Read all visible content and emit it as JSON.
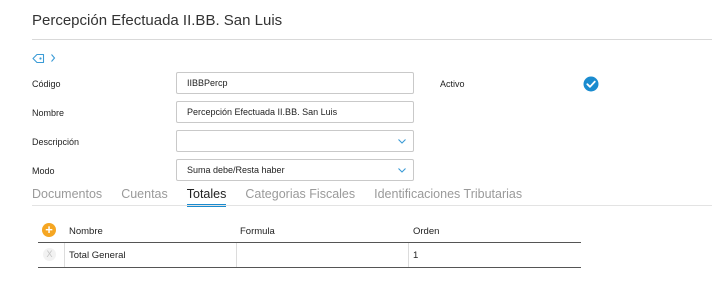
{
  "page": {
    "title": "Percepción Efectuada II.BB. San Luis"
  },
  "form": {
    "codigo": {
      "label": "Código",
      "value": "IIBBPercp"
    },
    "nombre": {
      "label": "Nombre",
      "value": "Percepción Efectuada II.BB. San Luis"
    },
    "descripcion": {
      "label": "Descripción",
      "value": ""
    },
    "modo": {
      "label": "Modo",
      "value": "Suma debe/Resta haber"
    },
    "activo": {
      "label": "Activo",
      "checked": true
    }
  },
  "tabs": [
    {
      "label": "Documentos",
      "active": false
    },
    {
      "label": "Cuentas",
      "active": false
    },
    {
      "label": "Totales",
      "active": true
    },
    {
      "label": "Categorias Fiscales",
      "active": false
    },
    {
      "label": "Identificaciones Tributarias",
      "active": false
    }
  ],
  "table": {
    "columns": [
      "Nombre",
      "Formula",
      "Orden"
    ],
    "add_icon": "plus",
    "delete_icon": "X",
    "rows": [
      {
        "nombre": "Total General",
        "formula": "",
        "orden": "1"
      }
    ]
  },
  "colors": {
    "accent": "#1a8bcf",
    "add_button": "#f5a623",
    "check": "#1a8bcf"
  },
  "icons": {
    "tag": "tag-icon",
    "expand": "chevron-right-icon",
    "dropdown": "chevron-down-icon",
    "active": "check-circle-icon"
  }
}
